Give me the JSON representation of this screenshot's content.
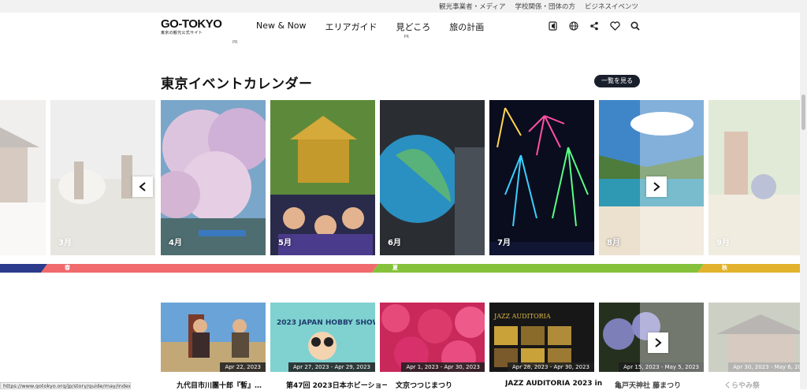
{
  "top_links": [
    "観光事業者・メディア",
    "学校関係・団体の方",
    "ビジネスイベンツ"
  ],
  "logo": {
    "title": "GO-TOKYO",
    "subtitle": "東京の観光公式サイト"
  },
  "nav": [
    {
      "label": "New & Now",
      "pr": ""
    },
    {
      "label": "エリアガイド",
      "pr": ""
    },
    {
      "label": "見どころ",
      "pr": "PR"
    },
    {
      "label": "旅の計画",
      "pr": ""
    }
  ],
  "logo_pr": "PR",
  "icons": [
    "audio-icon",
    "globe-icon",
    "share-icon",
    "heart-icon",
    "search-icon"
  ],
  "section_title": "東京イベントカレンダー",
  "see_all": "一覧を見る",
  "months": [
    {
      "label": "",
      "theme": "temple"
    },
    {
      "label": "3月",
      "theme": "fire"
    },
    {
      "label": "4月",
      "theme": "sakura"
    },
    {
      "label": "5月",
      "theme": "mikoshi"
    },
    {
      "label": "6月",
      "theme": "globe"
    },
    {
      "label": "7月",
      "theme": "fireworks"
    },
    {
      "label": "8月",
      "theme": "beach"
    },
    {
      "label": "9月",
      "theme": "park"
    }
  ],
  "seasons": [
    {
      "label": "春",
      "color": "#f06a6e"
    },
    {
      "label": "夏",
      "color": "#86c13c"
    },
    {
      "label": "秋",
      "color": "#e2b22c"
    }
  ],
  "events": [
    {
      "title": "九代目市川團十郎『暫』…",
      "date": "Apr 22, 2023",
      "theme": "sumo"
    },
    {
      "title": "第47回 2023日本ホビーショー",
      "date": "Apr 27, 2023 - Apr 29, 2023",
      "theme": "hobby"
    },
    {
      "title": "文京つつじまつり",
      "date": "Apr 1, 2023 - Apr 30, 2023",
      "theme": "azalea"
    },
    {
      "title": "JAZZ AUDITORIA 2023 in",
      "date": "Apr 28, 2023 - Apr 30, 2023",
      "theme": "jazz"
    },
    {
      "title": "亀戸天神社 藤まつり",
      "date": "Apr 15, 2023 - May 5, 2023",
      "theme": "wisteria"
    },
    {
      "title": "くらやみ祭",
      "date": "Apr 30, 2023 - May 6, 2023",
      "theme": "shrine"
    }
  ],
  "hobby_text": "2023 JAPAN HOBBY SHOW",
  "jazz_text": "JAZZ AUDITORIA",
  "status_url": "https://www.gotokyo.org/jp/story/guide/may/index.html"
}
